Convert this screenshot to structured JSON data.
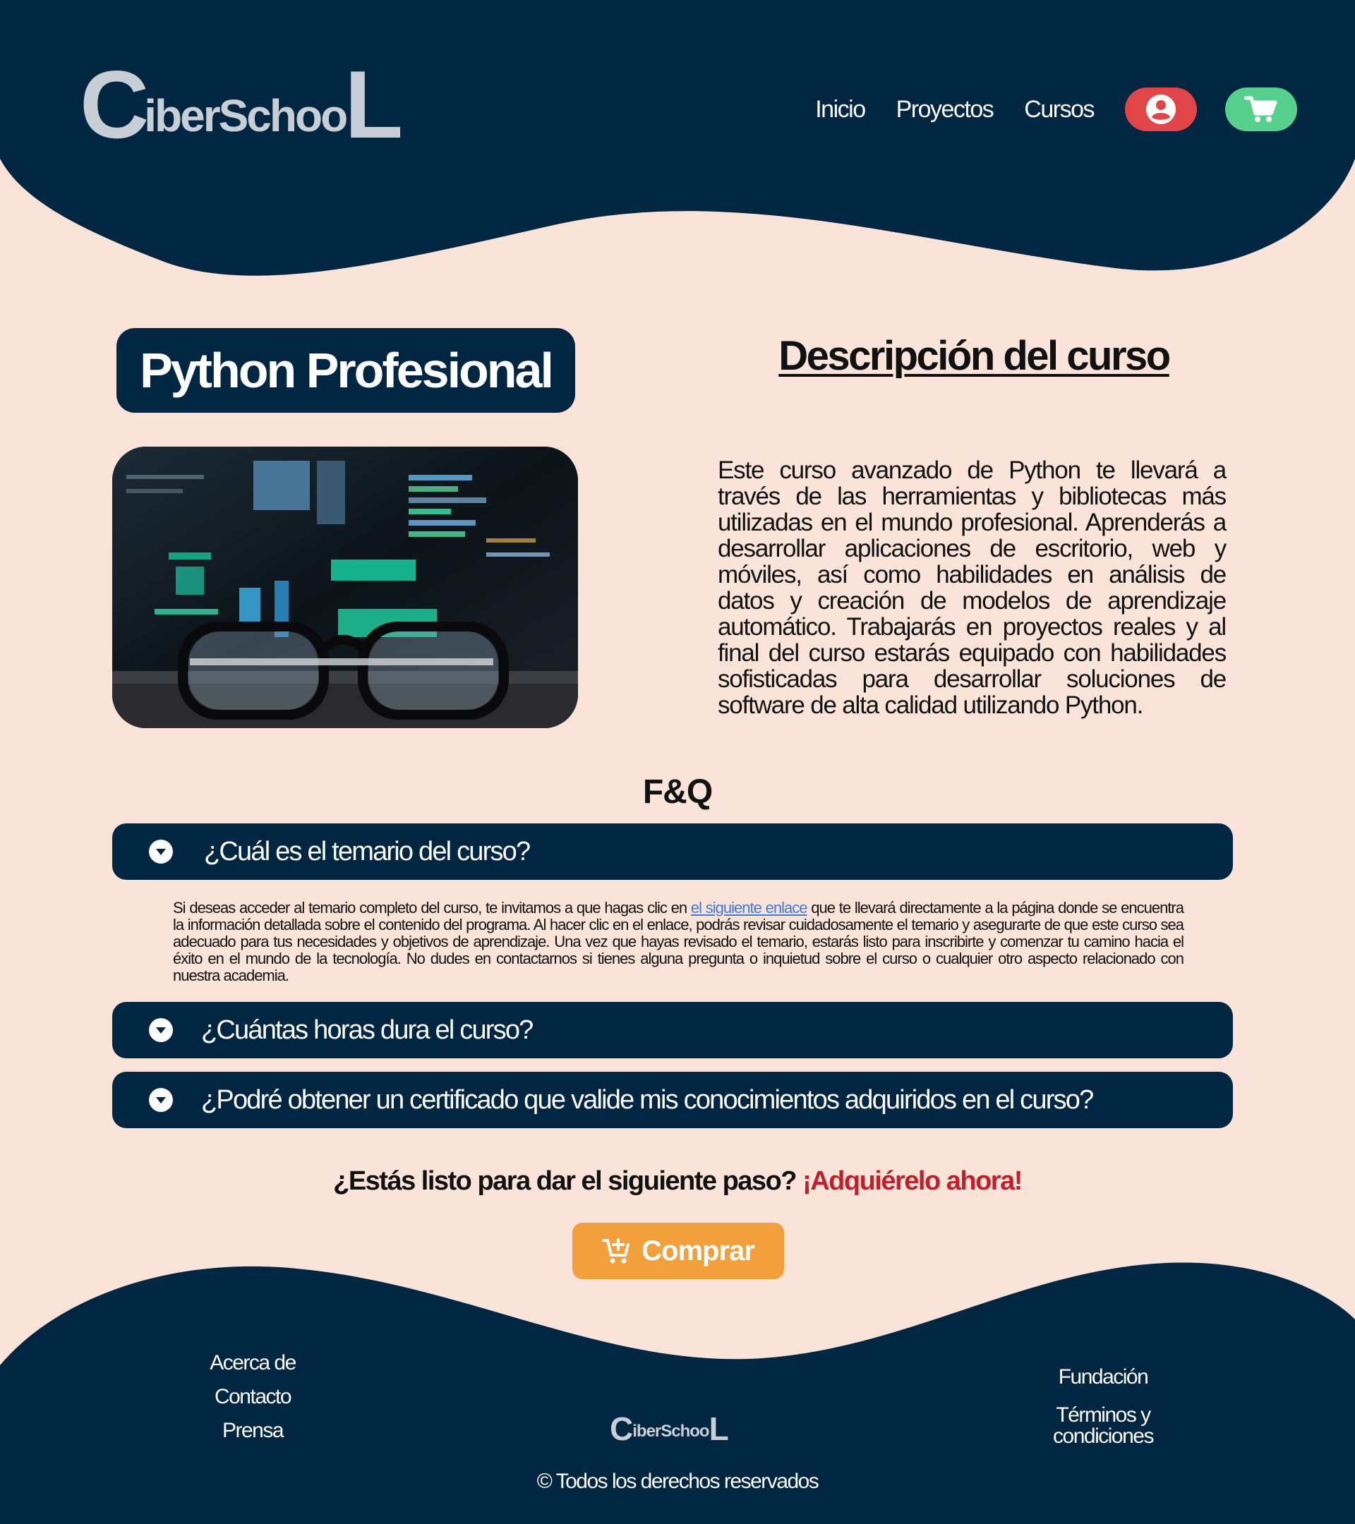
{
  "colors": {
    "navy": "#002641",
    "background": "#fae3d8",
    "user_button": "#e04547",
    "cart_button": "#55d18d",
    "buy_button": "#f2a03b",
    "accent_red": "#c21f2c",
    "logo_gray": "#c7ced6",
    "link_blue": "#3d7bd9"
  },
  "header": {
    "logo": {
      "first": "C",
      "middle": "iberSchoo",
      "last": "L"
    },
    "nav": [
      "Inicio",
      "Proyectos",
      "Cursos"
    ],
    "icons": {
      "user": "user-circle-icon",
      "cart": "shopping-cart-icon"
    }
  },
  "course": {
    "title": "Python Profesional",
    "image_alt": "Pantalla de código vista a través de unas gafas",
    "description_title": "Descripción del curso",
    "description": "Este curso avanzado de Python te llevará a través de las herramientas y bibliotecas más utilizadas en el mundo profesional. Aprenderás a desarrollar aplicaciones de escritorio, web y móviles, así como habilidades en análisis de datos y creación de modelos de aprendizaje automático. Trabajarás en proyectos reales y al final del curso estarás equipado con habilidades sofisticadas para desarrollar soluciones de software de alta calidad utilizando Python."
  },
  "faq": {
    "title": "F&Q",
    "items": [
      {
        "question": "¿Cuál es el temario del curso?",
        "expanded": true
      },
      {
        "question": "¿Cuántas horas dura el curso?",
        "expanded": false
      },
      {
        "question": "¿Podré obtener un certificado que valide mis conocimientos adquiridos en el curso?",
        "expanded": false
      }
    ],
    "answer": {
      "before_link": "Si deseas acceder al temario completo del curso, te invitamos a que hagas clic en ",
      "link_text": "el siguiente enlace",
      "after_link": " que te llevará directamente a la página donde se encuentra la información detallada sobre el contenido del programa. Al hacer clic en el enlace, podrás revisar cuidadosamente el temario y asegurarte de que este curso sea adecuado para tus necesidades y objetivos de aprendizaje. Una vez que hayas revisado el temario, estarás listo para inscribirte y comenzar tu camino hacia el éxito en el mundo de la tecnología. No dudes en contactarnos si tienes alguna pregunta o inquietud sobre el curso o cualquier otro aspecto relacionado con nuestra academia."
    }
  },
  "cta": {
    "question": "¿Estás listo para dar el siguiente paso?",
    "highlight": "¡Adquiérelo ahora!",
    "buy_label": "Comprar"
  },
  "footer": {
    "left_links": [
      "Acerca de",
      "Contacto",
      "Prensa"
    ],
    "right_links": [
      "Fundación",
      "Términos y condiciones"
    ],
    "logo": {
      "first": "C",
      "middle": "iberSchoo",
      "last": "L"
    },
    "copyright": "© Todos los derechos reservados"
  }
}
